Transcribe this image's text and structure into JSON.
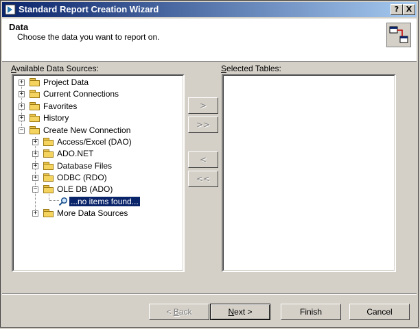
{
  "window": {
    "title": "Standard Report Creation Wizard",
    "help_label": "?",
    "close_label": "X"
  },
  "header": {
    "title": "Data",
    "subtitle": "Choose the data you want to report on."
  },
  "available": {
    "label_prefix": "A",
    "label_rest": "vailable Data Sources:",
    "tree": {
      "project_data": "Project Data",
      "current_connections": "Current Connections",
      "favorites": "Favorites",
      "history": "History",
      "create_new_connection": "Create New Connection",
      "access_excel": "Access/Excel (DAO)",
      "ado_net": "ADO.NET",
      "database_files": "Database Files",
      "odbc": "ODBC (RDO)",
      "ole_db": "OLE DB (ADO)",
      "no_items": "...no items found...",
      "more_data_sources": "More Data Sources"
    }
  },
  "selected": {
    "label_prefix": "S",
    "label_rest": "elected Tables:"
  },
  "transfer": {
    "add_one": ">",
    "add_all": ">>",
    "remove_one": "<",
    "remove_all": "<<"
  },
  "footer": {
    "back_prefix": "< ",
    "back_key": "B",
    "back_rest": "ack",
    "next_key": "N",
    "next_rest": "ext >",
    "finish": "Finish",
    "cancel": "Cancel"
  },
  "colors": {
    "title_bar": "#0a246a",
    "selection": "#0a246a",
    "face": "#d4d0c8"
  }
}
